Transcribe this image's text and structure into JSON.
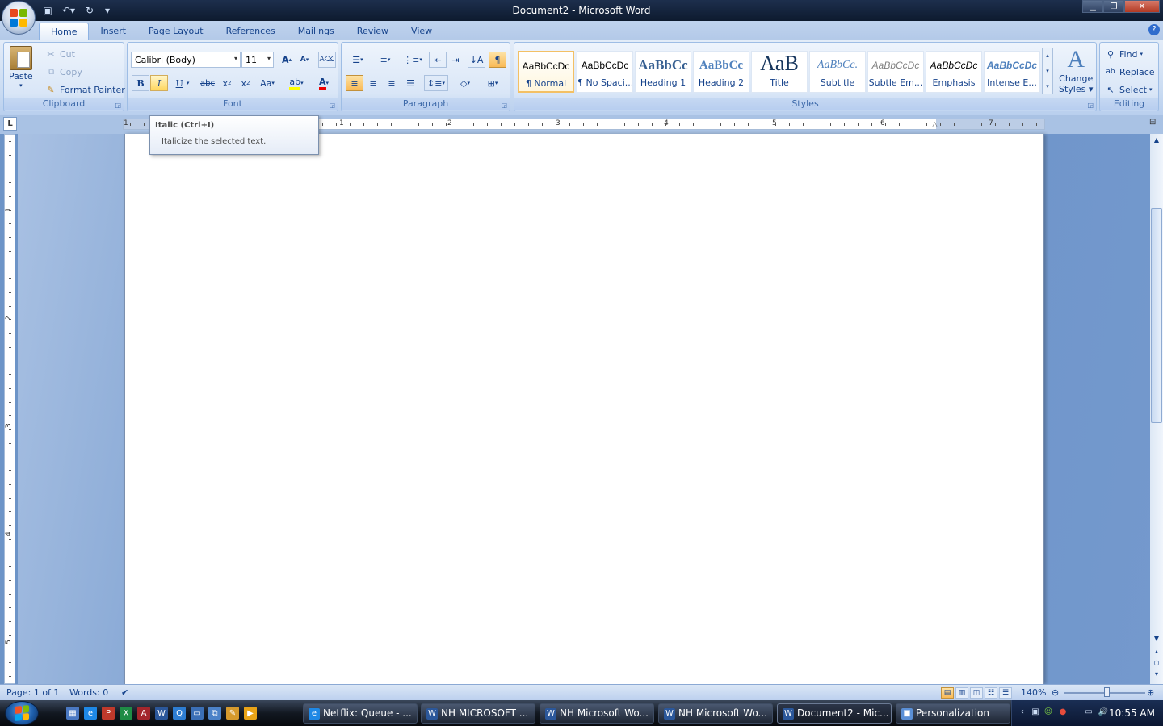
{
  "window": {
    "title": "Document2 - Microsoft Word"
  },
  "qat": {
    "save": "save-icon",
    "undo": "undo-icon",
    "redo": "redo-icon",
    "customize": "▾"
  },
  "tabs": [
    {
      "label": "Home",
      "active": true
    },
    {
      "label": "Insert"
    },
    {
      "label": "Page Layout"
    },
    {
      "label": "References"
    },
    {
      "label": "Mailings"
    },
    {
      "label": "Review"
    },
    {
      "label": "View"
    }
  ],
  "clipboard": {
    "label": "Clipboard",
    "paste": "Paste",
    "cut": "Cut",
    "copy": "Copy",
    "format_painter": "Format Painter"
  },
  "font": {
    "label": "Font",
    "family": "Calibri (Body)",
    "size": "11"
  },
  "paragraph": {
    "label": "Paragraph"
  },
  "styles": {
    "label": "Styles",
    "items": [
      {
        "sample": "AaBbCcDc",
        "name": "¶ Normal"
      },
      {
        "sample": "AaBbCcDc",
        "name": "¶ No Spaci..."
      },
      {
        "sample": "AaBbCc",
        "name": "Heading 1"
      },
      {
        "sample": "AaBbCc",
        "name": "Heading 2"
      },
      {
        "sample": "AaB",
        "name": "Title"
      },
      {
        "sample": "AaBbCc.",
        "name": "Subtitle"
      },
      {
        "sample": "AaBbCcDc",
        "name": "Subtle Em..."
      },
      {
        "sample": "AaBbCcDc",
        "name": "Emphasis"
      },
      {
        "sample": "AaBbCcDc",
        "name": "Intense E..."
      }
    ],
    "change_styles_line1": "Change",
    "change_styles_line2": "Styles"
  },
  "editing": {
    "label": "Editing",
    "find": "Find",
    "replace": "Replace",
    "select": "Select"
  },
  "tooltip": {
    "title": "Italic (Ctrl+I)",
    "body": "Italicize the selected text."
  },
  "ruler": {
    "tab_selector": "L",
    "numbers": [
      "1",
      "1",
      "2",
      "3",
      "4",
      "5",
      "6",
      "7"
    ]
  },
  "vruler": {
    "numbers": [
      "1",
      "2",
      "3",
      "4",
      "5"
    ]
  },
  "status": {
    "page": "Page: 1 of 1",
    "words": "Words: 0",
    "zoom": "140%"
  },
  "taskbar": {
    "tasks": [
      {
        "label": "Netflix: Queue - ..."
      },
      {
        "label": "NH MICROSOFT ..."
      },
      {
        "label": "NH Microsoft Wo..."
      },
      {
        "label": "NH Microsoft Wo..."
      },
      {
        "label": "Document2 - Mic...",
        "active": true
      },
      {
        "label": "Personalization"
      }
    ],
    "clock": "10:55 AM"
  }
}
